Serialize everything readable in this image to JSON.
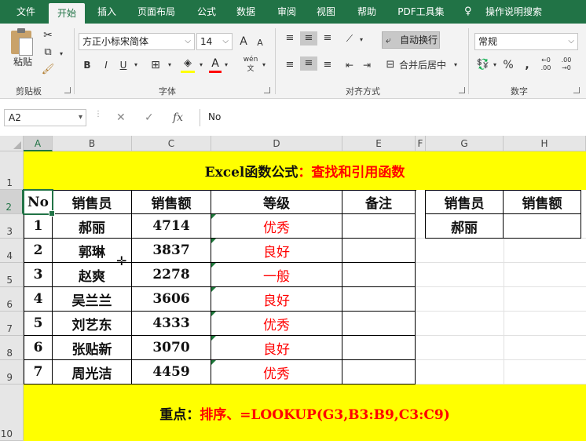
{
  "ribbon": {
    "tabs": [
      "文件",
      "开始",
      "插入",
      "页面布局",
      "公式",
      "数据",
      "审阅",
      "视图",
      "帮助",
      "PDF工具集",
      "操作说明搜索"
    ],
    "active_tab": "开始",
    "clipboard": {
      "paste_label": "粘贴",
      "group_label": "剪贴板"
    },
    "font": {
      "name": "方正小标宋简体",
      "size": "14",
      "bold": "B",
      "italic": "I",
      "underline": "U",
      "grow": "A",
      "shrink": "A",
      "wen": "wén",
      "group_label": "字体"
    },
    "alignment": {
      "wrap_label": "自动换行",
      "merge_label": "合并后居中",
      "group_label": "对齐方式"
    },
    "number": {
      "format": "常规",
      "percent": "%",
      "comma": ",",
      "group_label": "数字"
    }
  },
  "formula_bar": {
    "name_box": "A2",
    "cancel": "✕",
    "enter": "✓",
    "fx": "fx",
    "value": "No"
  },
  "sheet": {
    "columns": [
      "A",
      "B",
      "C",
      "D",
      "E",
      "F",
      "G",
      "H"
    ],
    "rows": [
      "1",
      "2",
      "3",
      "4",
      "5",
      "6",
      "7",
      "8",
      "9",
      "10"
    ],
    "title": {
      "black": "Excel函数公式",
      "red": "：查找和引用函数"
    },
    "headers": [
      "No",
      "销售员",
      "销售额",
      "等级",
      "备注"
    ],
    "data": [
      [
        "1",
        "郝丽",
        "4714",
        "优秀",
        ""
      ],
      [
        "2",
        "郭琳",
        "3837",
        "良好",
        ""
      ],
      [
        "3",
        "赵爽",
        "2278",
        "一般",
        ""
      ],
      [
        "4",
        "吴兰兰",
        "3606",
        "良好",
        ""
      ],
      [
        "5",
        "刘艺东",
        "4333",
        "优秀",
        ""
      ],
      [
        "6",
        "张贴新",
        "3070",
        "良好",
        ""
      ],
      [
        "7",
        "周光洁",
        "4459",
        "优秀",
        ""
      ]
    ],
    "lookup_headers": [
      "销售员",
      "销售额"
    ],
    "lookup_row": [
      "郝丽",
      ""
    ],
    "note": {
      "black": "重点：",
      "red": "排序、=LOOKUP(G3,B3:B9,C3:C9)"
    }
  },
  "colors": {
    "brand": "#217346",
    "highlight": "#ffff00",
    "accent_red": "#ff0000"
  }
}
